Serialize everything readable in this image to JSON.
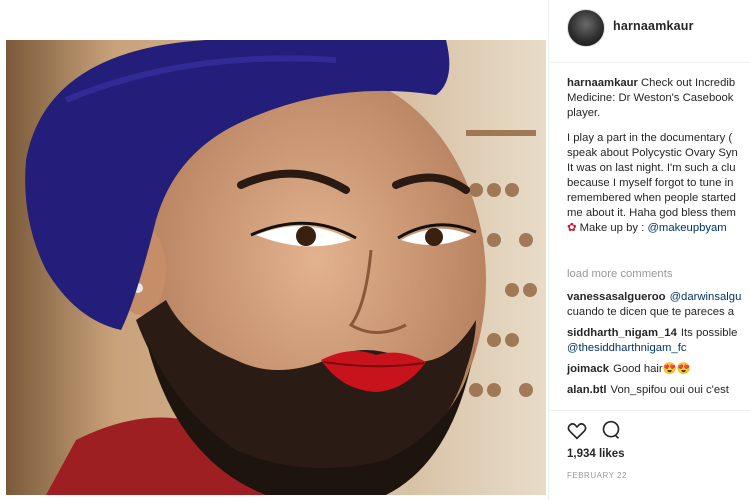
{
  "post": {
    "username": "harnaamkaur"
  },
  "caption": {
    "username": "harnaamkaur",
    "lines": [
      "Check out Incredib",
      "Medicine: Dr Weston's Casebook",
      "player."
    ],
    "para2": [
      "I play a part in the documentary (",
      "speak about Polycystic Ovary Syn",
      "It was on last night. I'm such a clu",
      "because I myself forgot to tune in",
      "remembered when people started",
      "me about it. Haha god bless them"
    ],
    "makeup_prefix": "Make up by : ",
    "makeup_mention": "@makeupbyam"
  },
  "load_more": "load more comments",
  "comments": [
    {
      "user": "vanessasalgueroo",
      "mention": "@darwinsalgu",
      "text": "cuando te dicen que te pareces a"
    },
    {
      "user": "siddharth_nigam_14",
      "text": "Its possible",
      "mention2": "@thesiddharthnigam_fc"
    },
    {
      "user": "joimack",
      "text": "Good hair😍😍"
    },
    {
      "user": "alan.btl",
      "text": "Von_spifou oui oui c'est"
    }
  ],
  "likes": "1,934 likes",
  "date": "FEBRUARY 22",
  "colors": {
    "link": "#003569",
    "muted": "#999999",
    "text": "#262626"
  }
}
